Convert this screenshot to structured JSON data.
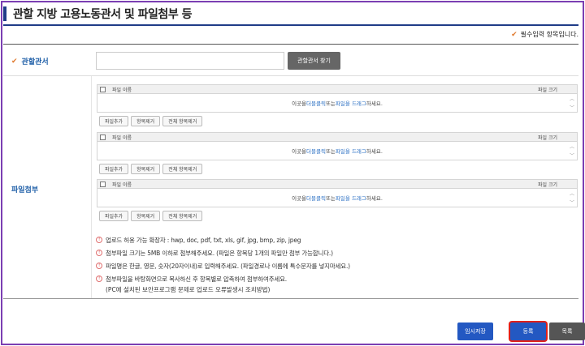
{
  "page": {
    "title": "관할 지방 고용노동관서 및 파일첨부 등"
  },
  "required_note": "필수입력 항목입니다.",
  "office": {
    "label": "관할관서",
    "value": "",
    "find_button": "관할관서 찾기"
  },
  "attachment": {
    "label": "파일첨부",
    "groups": [
      {
        "col_name": "파일 이름",
        "col_size": "파일 크기",
        "drop_pre": "이곳을 ",
        "drop_link1": "더블클릭",
        "drop_mid": " 또는 ",
        "drop_link2": "파일을 드래그",
        "drop_post": " 하세요.",
        "buttons": [
          "파일추가",
          "항목제거",
          "전체 항목제거"
        ]
      },
      {
        "col_name": "파일 이름",
        "col_size": "파일 크기",
        "drop_pre": "이곳을 ",
        "drop_link1": "더블클릭",
        "drop_mid": " 또는 ",
        "drop_link2": "파일을 드래그",
        "drop_post": " 하세요.",
        "buttons": [
          "파일추가",
          "항목제거",
          "전체 항목제거"
        ]
      },
      {
        "col_name": "파일 이름",
        "col_size": "파일 크기",
        "drop_pre": "이곳을 ",
        "drop_link1": "더블클릭",
        "drop_mid": " 또는 ",
        "drop_link2": "파일을 드래그",
        "drop_post": " 하세요.",
        "buttons": [
          "파일추가",
          "항목제거",
          "전체 항목제거"
        ]
      }
    ]
  },
  "notes": [
    "업로드 허용 가능 확장자 : hwp, doc, pdf, txt, xls, gif, jpg, bmp, zip, jpeg",
    "첨부파일 크기는 5MB 이하로 첨부해주세요. (파일은 항목당 1개의 파일만 첨부 가능합니다.)",
    "파일명은 한글, 영문, 숫자(20자이내)로 입력해주세요. (파일경로나 이름에 특수문자를 넣지마세요.)",
    "첨부파일을 바탕화면으로 복사하신 후 항목별로 압축하여 첨부하여주세요."
  ],
  "note_sub": "(PC에 설치된 보안프로그램 문제로 업로드 오류발생시 조치방법)",
  "actions": {
    "temp_save": "임시저장",
    "register": "등록",
    "list": "목록"
  },
  "icons": {
    "check": "check-icon",
    "info": "info-icon"
  },
  "colors": {
    "accent": "#1f3c88",
    "link": "#2a6fc4",
    "primary_button": "#2358c2",
    "highlight": "#e0201a"
  }
}
